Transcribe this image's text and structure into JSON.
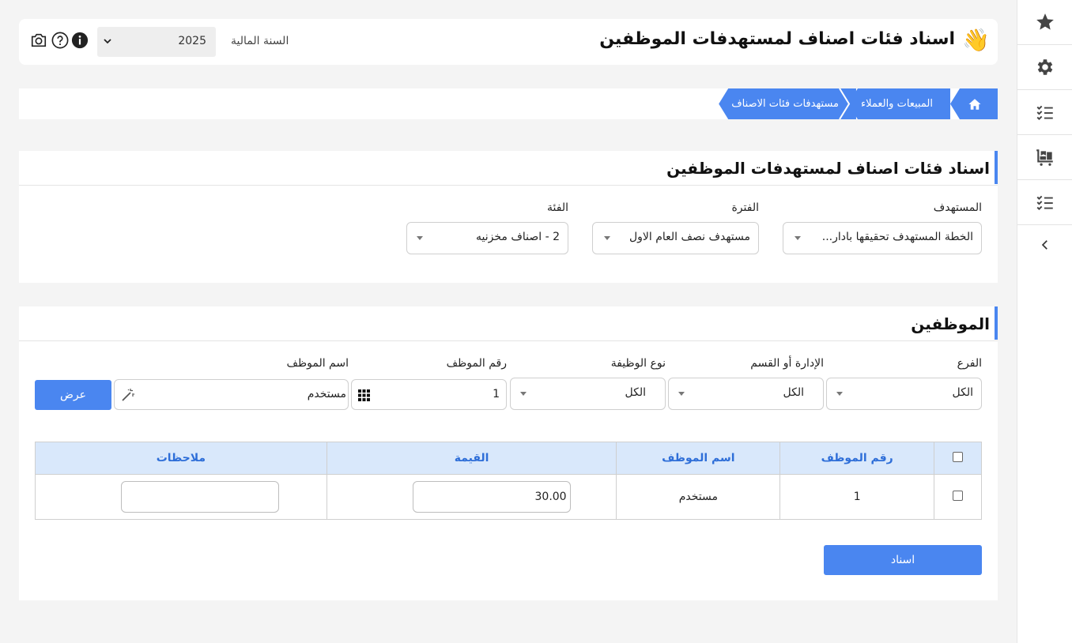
{
  "header": {
    "title": "اسناد فئات اصناف لمستهدفات الموظفين",
    "wave_emoji": "👋",
    "fiscal_year_label": "السنة المالية",
    "fiscal_year_value": "2025",
    "icons": [
      "info-icon",
      "help-icon",
      "camera-icon"
    ]
  },
  "breadcrumb": {
    "items": [
      {
        "label": "",
        "icon": "home-icon"
      },
      {
        "label": "المبيعات والعملاء"
      },
      {
        "label": "مستهدفات فئات الاصناف"
      }
    ]
  },
  "filters_panel": {
    "title": "اسناد فئات اصناف لمستهدفات الموظفين",
    "target_label": "المستهدف",
    "target_value": "الخطة المستهدف تحقيقها بادار...",
    "period_label": "الفترة",
    "period_value": "مستهدف نصف العام الاول",
    "category_label": "الفئة",
    "category_value": "2 - اصناف مخزنيه"
  },
  "employees_panel": {
    "title": "الموظفين",
    "branch_label": "الفرع",
    "branch_value": "الكل",
    "dept_label": "الإدارة أو القسم",
    "dept_value": "الكل",
    "jobtype_label": "نوع الوظيفة",
    "jobtype_value": "الكل",
    "empno_label": "رقم الموظف",
    "empno_value": "1",
    "empname_label": "اسم الموظف",
    "empname_value": "مستخدم",
    "show_button": "عرض",
    "table": {
      "headers": {
        "emp_no": "رقم الموظف",
        "emp_name": "اسم الموظف",
        "value": "القيمة",
        "notes": "ملاحظات"
      },
      "rows": [
        {
          "emp_no": "1",
          "emp_name": "مستخدم",
          "value": "30.00",
          "notes": ""
        }
      ]
    },
    "assign_button": "اسناد"
  },
  "sidebar": {
    "items": [
      "star-icon",
      "gear-icon",
      "checklist-icon",
      "delivery-cart-icon",
      "checklist-icon",
      "chevron-left-icon"
    ]
  },
  "colors": {
    "accent": "#4a86f0",
    "table_header_bg": "#d9e8fb",
    "table_header_text": "#2e6ed8"
  }
}
